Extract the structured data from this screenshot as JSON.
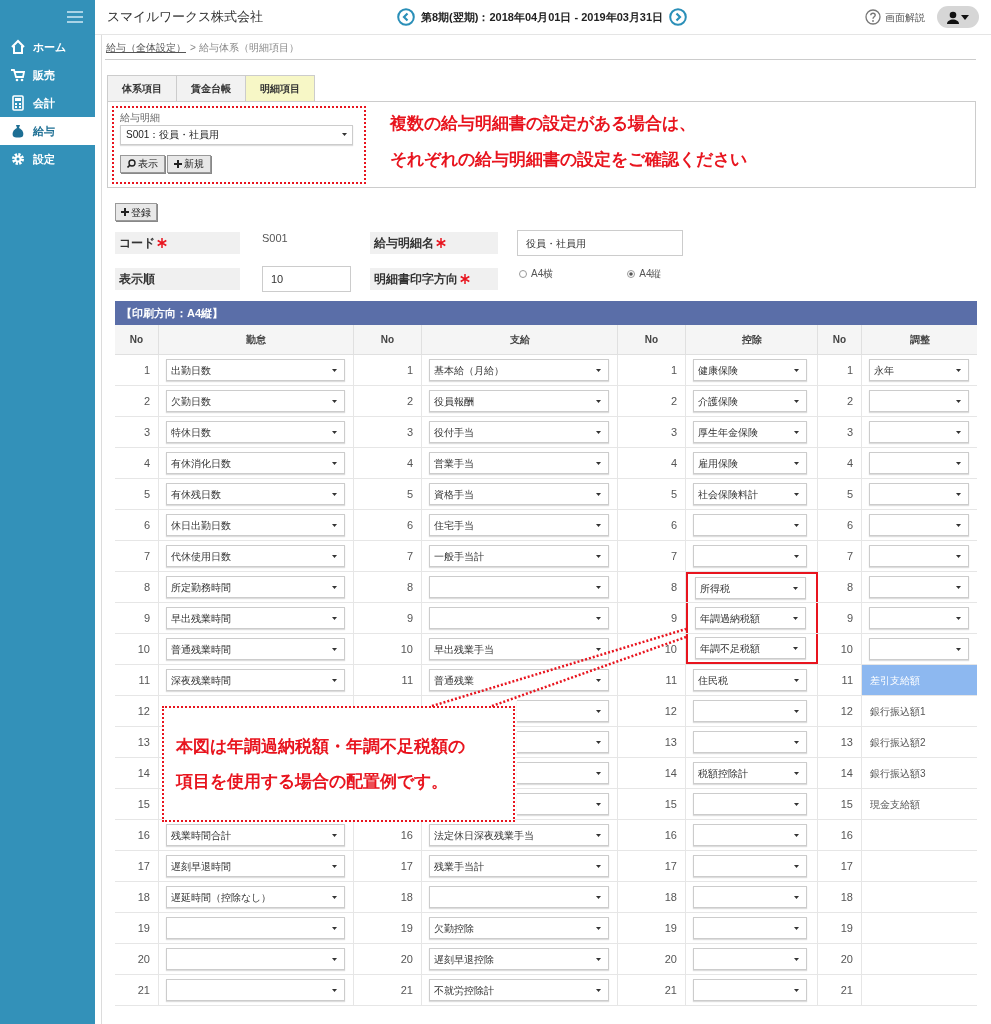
{
  "sidebar": {
    "items": [
      {
        "label": "ホーム",
        "selected": false
      },
      {
        "label": "販売",
        "selected": false
      },
      {
        "label": "会計",
        "selected": false
      },
      {
        "label": "給与",
        "selected": true
      },
      {
        "label": "設定",
        "selected": false
      }
    ]
  },
  "header": {
    "company": "スマイルワークス株式会社",
    "period": "第8期(翌期)：2018年04月01日 - 2019年03月31日",
    "help": "画面解説"
  },
  "breadcrumb": [
    {
      "label": "給与（全体設定）",
      "link": true
    },
    {
      "label": "> 給与体系（明細項目）",
      "link": false
    }
  ],
  "tabs": [
    {
      "label": "体系項目",
      "selected": false
    },
    {
      "label": "賃金台帳",
      "selected": false
    },
    {
      "label": "明細項目",
      "selected": true
    }
  ],
  "payslip_picker": {
    "label": "給与明細",
    "value": "S001：役員・社員用",
    "buttons": [
      {
        "label": "表示",
        "kind": "search"
      },
      {
        "label": "新規",
        "kind": "add"
      }
    ]
  },
  "top_note": [
    "複数の給与明細書の設定がある場合は、",
    "それぞれの給与明細書の設定をご確認ください"
  ],
  "register_button": "登録",
  "form": {
    "code": {
      "label": "コード",
      "required": true,
      "value": "S001"
    },
    "name": {
      "label": "給与明細名",
      "required": true,
      "value": "役員・社員用"
    },
    "order": {
      "label": "表示順",
      "required": false,
      "value": "10"
    },
    "orientation": {
      "label": "明細書印字方向",
      "required": true,
      "options": [
        {
          "label": "A4横",
          "selected": false
        },
        {
          "label": "A4縦",
          "selected": true
        }
      ]
    }
  },
  "table": {
    "title": "【印刷方向：A4縦】",
    "groups": [
      {
        "no_header": "No",
        "header": "勤怠",
        "cells": [
          {
            "no": "1",
            "kind": "select",
            "value": "出勤日数"
          },
          {
            "no": "2",
            "kind": "select",
            "value": "欠勤日数"
          },
          {
            "no": "3",
            "kind": "select",
            "value": "特休日数"
          },
          {
            "no": "4",
            "kind": "select",
            "value": "有休消化日数"
          },
          {
            "no": "5",
            "kind": "select",
            "value": "有休残日数"
          },
          {
            "no": "6",
            "kind": "select",
            "value": "休日出勤日数"
          },
          {
            "no": "7",
            "kind": "select",
            "value": "代休使用日数"
          },
          {
            "no": "8",
            "kind": "select",
            "value": "所定勤務時間"
          },
          {
            "no": "9",
            "kind": "select",
            "value": "早出残業時間"
          },
          {
            "no": "10",
            "kind": "select",
            "value": "普通残業時間"
          },
          {
            "no": "11",
            "kind": "select",
            "value": "深夜残業時間"
          },
          {
            "no": "12",
            "kind": "blank"
          },
          {
            "no": "13",
            "kind": "blank"
          },
          {
            "no": "14",
            "kind": "blank"
          },
          {
            "no": "15",
            "kind": "blank"
          },
          {
            "no": "16",
            "kind": "select",
            "value": "残業時間合計"
          },
          {
            "no": "17",
            "kind": "select",
            "value": "遅刻早退時間"
          },
          {
            "no": "18",
            "kind": "select",
            "value": "遅延時間（控除なし）"
          },
          {
            "no": "19",
            "kind": "select"
          },
          {
            "no": "20",
            "kind": "select"
          },
          {
            "no": "21",
            "kind": "select"
          }
        ]
      },
      {
        "no_header": "No",
        "header": "支給",
        "cells": [
          {
            "no": "1",
            "kind": "select",
            "value": "基本給（月給）"
          },
          {
            "no": "2",
            "kind": "select",
            "value": "役員報酬"
          },
          {
            "no": "3",
            "kind": "select",
            "value": "役付手当"
          },
          {
            "no": "4",
            "kind": "select",
            "value": "営業手当"
          },
          {
            "no": "5",
            "kind": "select",
            "value": "資格手当"
          },
          {
            "no": "6",
            "kind": "select",
            "value": "住宅手当"
          },
          {
            "no": "7",
            "kind": "select",
            "value": "一般手当計"
          },
          {
            "no": "8",
            "kind": "select"
          },
          {
            "no": "9",
            "kind": "select"
          },
          {
            "no": "10",
            "kind": "select",
            "value": "早出残業手当"
          },
          {
            "no": "11",
            "kind": "select",
            "value": "普通残業"
          },
          {
            "kind": "partial_select"
          },
          {
            "kind": "partial_select"
          },
          {
            "kind": "partial_select"
          },
          {
            "kind": "partial_select"
          },
          {
            "no": "16",
            "kind": "select",
            "value": "法定休日深夜残業手当"
          },
          {
            "no": "17",
            "kind": "select",
            "value": "残業手当計"
          },
          {
            "no": "18",
            "kind": "select"
          },
          {
            "no": "19",
            "kind": "select",
            "value": "欠勤控除"
          },
          {
            "no": "20",
            "kind": "select",
            "value": "遅刻早退控除"
          },
          {
            "no": "21",
            "kind": "select",
            "value": "不就労控除計"
          }
        ]
      },
      {
        "no_header": "No",
        "header": "控除",
        "cells": [
          {
            "no": "1",
            "kind": "select",
            "value": "健康保険",
            "highlighted": false
          },
          {
            "no": "2",
            "kind": "select",
            "value": "介護保険",
            "highlighted": false
          },
          {
            "no": "3",
            "kind": "select",
            "value": "厚生年金保険",
            "highlighted": false
          },
          {
            "no": "4",
            "kind": "select",
            "value": "雇用保険",
            "highlighted": false
          },
          {
            "no": "5",
            "kind": "select",
            "value": "社会保険料計",
            "highlighted": false
          },
          {
            "no": "6",
            "kind": "select",
            "highlighted": false
          },
          {
            "no": "7",
            "kind": "select",
            "highlighted": false
          },
          {
            "no": "8",
            "kind": "select",
            "value": "所得税",
            "highlighted": true
          },
          {
            "no": "9",
            "kind": "select",
            "value": "年調過納税額",
            "highlighted": true
          },
          {
            "no": "10",
            "kind": "select",
            "value": "年調不足税額",
            "highlighted": true
          },
          {
            "no": "11",
            "kind": "select",
            "value": "住民税",
            "highlighted": false
          },
          {
            "no": "12",
            "kind": "select",
            "highlighted": false
          },
          {
            "no": "13",
            "kind": "select",
            "highlighted": false
          },
          {
            "no": "14",
            "kind": "select",
            "value": "税額控除計",
            "highlighted": false
          },
          {
            "no": "15",
            "kind": "select",
            "highlighted": false
          },
          {
            "no": "16",
            "kind": "select",
            "highlighted": false
          },
          {
            "no": "17",
            "kind": "select",
            "highlighted": false
          },
          {
            "no": "18",
            "kind": "select",
            "highlighted": false
          },
          {
            "no": "19",
            "kind": "select",
            "highlighted": false
          },
          {
            "no": "20",
            "kind": "select",
            "highlighted": false
          },
          {
            "no": "21",
            "kind": "select",
            "highlighted": false
          }
        ]
      },
      {
        "no_header": "No",
        "header": "調整",
        "cells": [
          {
            "no": "1",
            "kind": "select",
            "value": "永年"
          },
          {
            "no": "2",
            "kind": "select"
          },
          {
            "no": "3",
            "kind": "select"
          },
          {
            "no": "4",
            "kind": "select"
          },
          {
            "no": "5",
            "kind": "select"
          },
          {
            "no": "6",
            "kind": "select"
          },
          {
            "no": "7",
            "kind": "select"
          },
          {
            "no": "8",
            "kind": "select"
          },
          {
            "no": "9",
            "kind": "select"
          },
          {
            "no": "10",
            "kind": "select"
          },
          {
            "no": "11",
            "kind": "text",
            "value": "差引支給額",
            "selected": true
          },
          {
            "no": "12",
            "kind": "text",
            "value": "銀行振込額1",
            "selected": false
          },
          {
            "no": "13",
            "kind": "text",
            "value": "銀行振込額2",
            "selected": false
          },
          {
            "no": "14",
            "kind": "text",
            "value": "銀行振込額3",
            "selected": false
          },
          {
            "no": "15",
            "kind": "text",
            "value": "現金支給額",
            "selected": false
          },
          {
            "no": "16",
            "kind": "blank"
          },
          {
            "no": "17",
            "kind": "blank"
          },
          {
            "no": "18",
            "kind": "blank"
          },
          {
            "no": "19",
            "kind": "blank"
          },
          {
            "no": "20",
            "kind": "blank"
          },
          {
            "no": "21",
            "kind": "blank"
          }
        ]
      }
    ]
  },
  "callout": {
    "lines": [
      "本図は年調過納税額・年調不足税額の",
      "項目を使用する場合の配置例です。"
    ]
  }
}
